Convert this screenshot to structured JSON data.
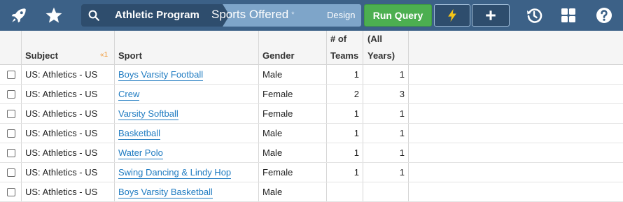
{
  "toolbar": {
    "breadcrumb": {
      "first": "Athletic Program",
      "second": "Sports Offered",
      "modified_marker": "*"
    },
    "design_label": "Design",
    "run_query_label": "Run Query",
    "icons": [
      "rocket-icon",
      "star-icon",
      "search-icon",
      "lightning-icon",
      "plus-icon",
      "history-icon",
      "grid-icon",
      "help-icon"
    ]
  },
  "table": {
    "headers": {
      "subject": "Subject",
      "sport": "Sport",
      "gender": "Gender",
      "teams_line1": "# of",
      "teams_line2": "Teams",
      "all_line1": "(All",
      "all_line2": "Years)"
    },
    "sort_indicator": {
      "arrow": "«",
      "order": "1"
    },
    "rows": [
      {
        "subject": "US: Athletics - US",
        "sport": "Boys Varsity Football",
        "gender": "Male",
        "teams": "1",
        "all_years": "1"
      },
      {
        "subject": "US: Athletics - US",
        "sport": "Crew",
        "gender": "Female",
        "teams": "2",
        "all_years": "3"
      },
      {
        "subject": "US: Athletics - US",
        "sport": "Varsity Softball",
        "gender": "Female",
        "teams": "1",
        "all_years": "1"
      },
      {
        "subject": "US: Athletics - US",
        "sport": "Basketball",
        "gender": "Male",
        "teams": "1",
        "all_years": "1"
      },
      {
        "subject": "US: Athletics - US",
        "sport": "Water Polo",
        "gender": "Male",
        "teams": "1",
        "all_years": "1"
      },
      {
        "subject": "US: Athletics - US",
        "sport": "Swing Dancing & Lindy Hop",
        "gender": "Female",
        "teams": "1",
        "all_years": "1"
      },
      {
        "subject": "US: Athletics - US",
        "sport": "Boys Varsity Basketball",
        "gender": "Male",
        "teams": "",
        "all_years": ""
      }
    ]
  },
  "colors": {
    "toolbar_bg": "#3c6187",
    "run_button": "#4caf50",
    "link": "#1f7bc1",
    "sort_indicator": "#f0932b"
  }
}
